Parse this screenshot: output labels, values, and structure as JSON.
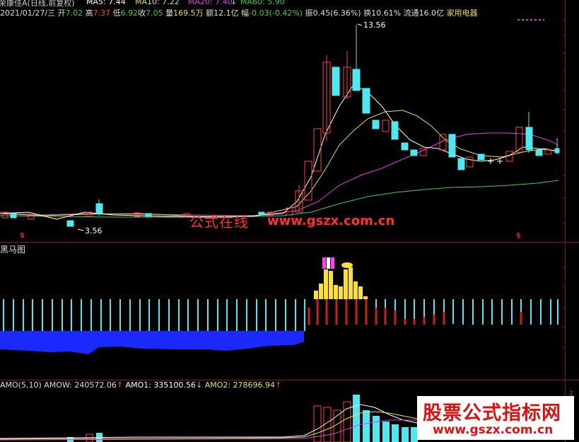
{
  "main_header": {
    "title": "荣康佳A(日线,前复权)",
    "ma5": "MA5: 7.44",
    "ma10": "MA10: 7.22",
    "ma20": "MA20: 7.40",
    "ma60": "MA60: 5.90",
    "arrow_down": "↓",
    "arrow_up": "↑"
  },
  "quote": {
    "date": "2021/01/27/三",
    "open_label": "开",
    "open": "7.02",
    "high_label": "高",
    "high": "7.37",
    "low_label": "低",
    "low": "6.92",
    "close_label": "收",
    "close": "7.05",
    "vol_label": "量",
    "vol": "169.5万",
    "amount_label": "额",
    "amount": "12.1亿",
    "change_label": "幅",
    "change": "-0.03(-0.42%)",
    "amp_label": "振",
    "amp": "0.45(6.36%)",
    "turnover_label": "换",
    "turnover": "10.61%",
    "float_label": "流通",
    "float": "16.0亿",
    "industry": "家用电器"
  },
  "annotations": {
    "high_marker": "13.56",
    "low_marker": "3.56"
  },
  "indicator_panel": {
    "title": "黑马图"
  },
  "amo_panel": {
    "title": "AMO(5,10)",
    "amow": "AMOW: 240572.06",
    "amo1": "AMO1: 335100.56",
    "amo2": "AMO2: 278696.94",
    "up_arrow": "↑",
    "down_arrow": "↓"
  },
  "watermarks": {
    "text_cn": "公式在线",
    "url1": "www.gszx.com.cn",
    "brand_cn": "股票公式指标网",
    "brand_url": "www.gszx.com.cn"
  },
  "colors": {
    "up": "#ff4040",
    "down": "#4fe8f0",
    "ma5": "#ffffff",
    "ma10": "#e8e050",
    "ma20": "#e040e0",
    "ma60": "#40d040",
    "grid": "#8a1414"
  },
  "chart_data": {
    "type": "candlestick",
    "title": "荣康佳A(日线,前复权)",
    "price_high": 13.56,
    "price_low": 3.56,
    "last_close": 7.05,
    "moving_averages": {
      "MA5": 7.44,
      "MA10": 7.22,
      "MA20": 7.4,
      "MA60": 5.9
    }
  }
}
